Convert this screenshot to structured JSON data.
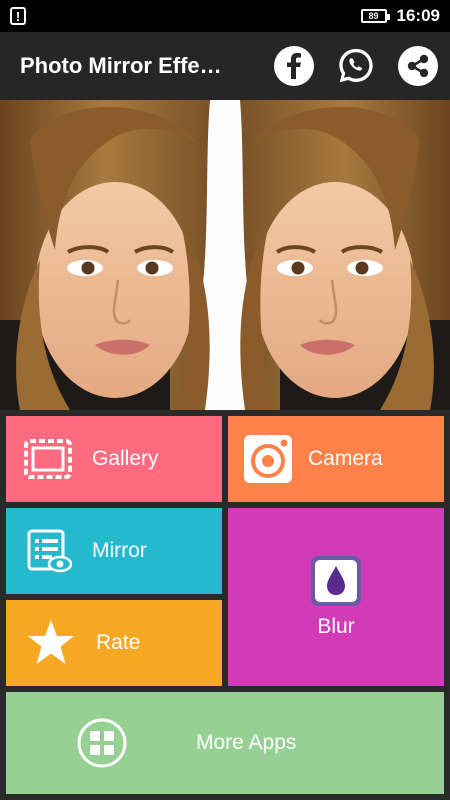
{
  "status_bar": {
    "notification_icon": "exclamation-notification-icon",
    "battery": "89",
    "time": "16:09"
  },
  "app_bar": {
    "title": "Photo Mirror Effe…",
    "actions": [
      "facebook-icon",
      "whatsapp-icon",
      "share-icon"
    ]
  },
  "photo": {
    "description_icon": "mirrored-portrait-image"
  },
  "tiles": {
    "gallery": {
      "label": "Gallery",
      "icon": "frame-icon",
      "color": "#fe6a80"
    },
    "camera": {
      "label": "Camera",
      "icon": "camera-lens-icon",
      "color": "#fd8249"
    },
    "mirror": {
      "label": "Mirror",
      "icon": "list-eye-icon",
      "color": "#25b9cd"
    },
    "rate": {
      "label": "Rate",
      "icon": "star-icon",
      "color": "#f6a824"
    },
    "blur": {
      "label": "Blur",
      "icon": "drop-icon",
      "color": "#d23bb7"
    },
    "more_apps": {
      "label": "More Apps",
      "icon": "grid-icon",
      "color": "#97d093"
    }
  }
}
